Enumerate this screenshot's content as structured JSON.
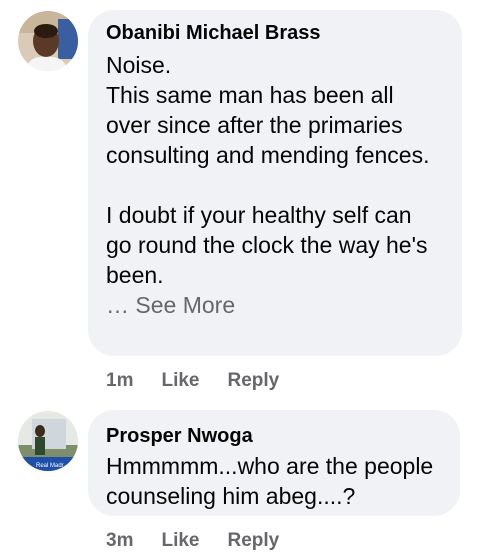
{
  "comments": [
    {
      "author": "Obanibi Michael Brass",
      "text": "Noise.\nThis same man has been all over since after the primaries consulting and mending fences.\n\nI doubt if your healthy self can go round the clock the way he's been.",
      "see_more": "… See More",
      "time": "1m",
      "like": "Like",
      "reply": "Reply"
    },
    {
      "author": "Prosper Nwoga",
      "text": "Hmmmmm...who are the people counseling him abeg....?",
      "avatar_caption": "Real Madr",
      "time": "3m",
      "like": "Like",
      "reply": "Reply"
    }
  ],
  "colors": {
    "bubble": "#f0f2f5",
    "text": "#050505",
    "meta": "#65676b"
  }
}
